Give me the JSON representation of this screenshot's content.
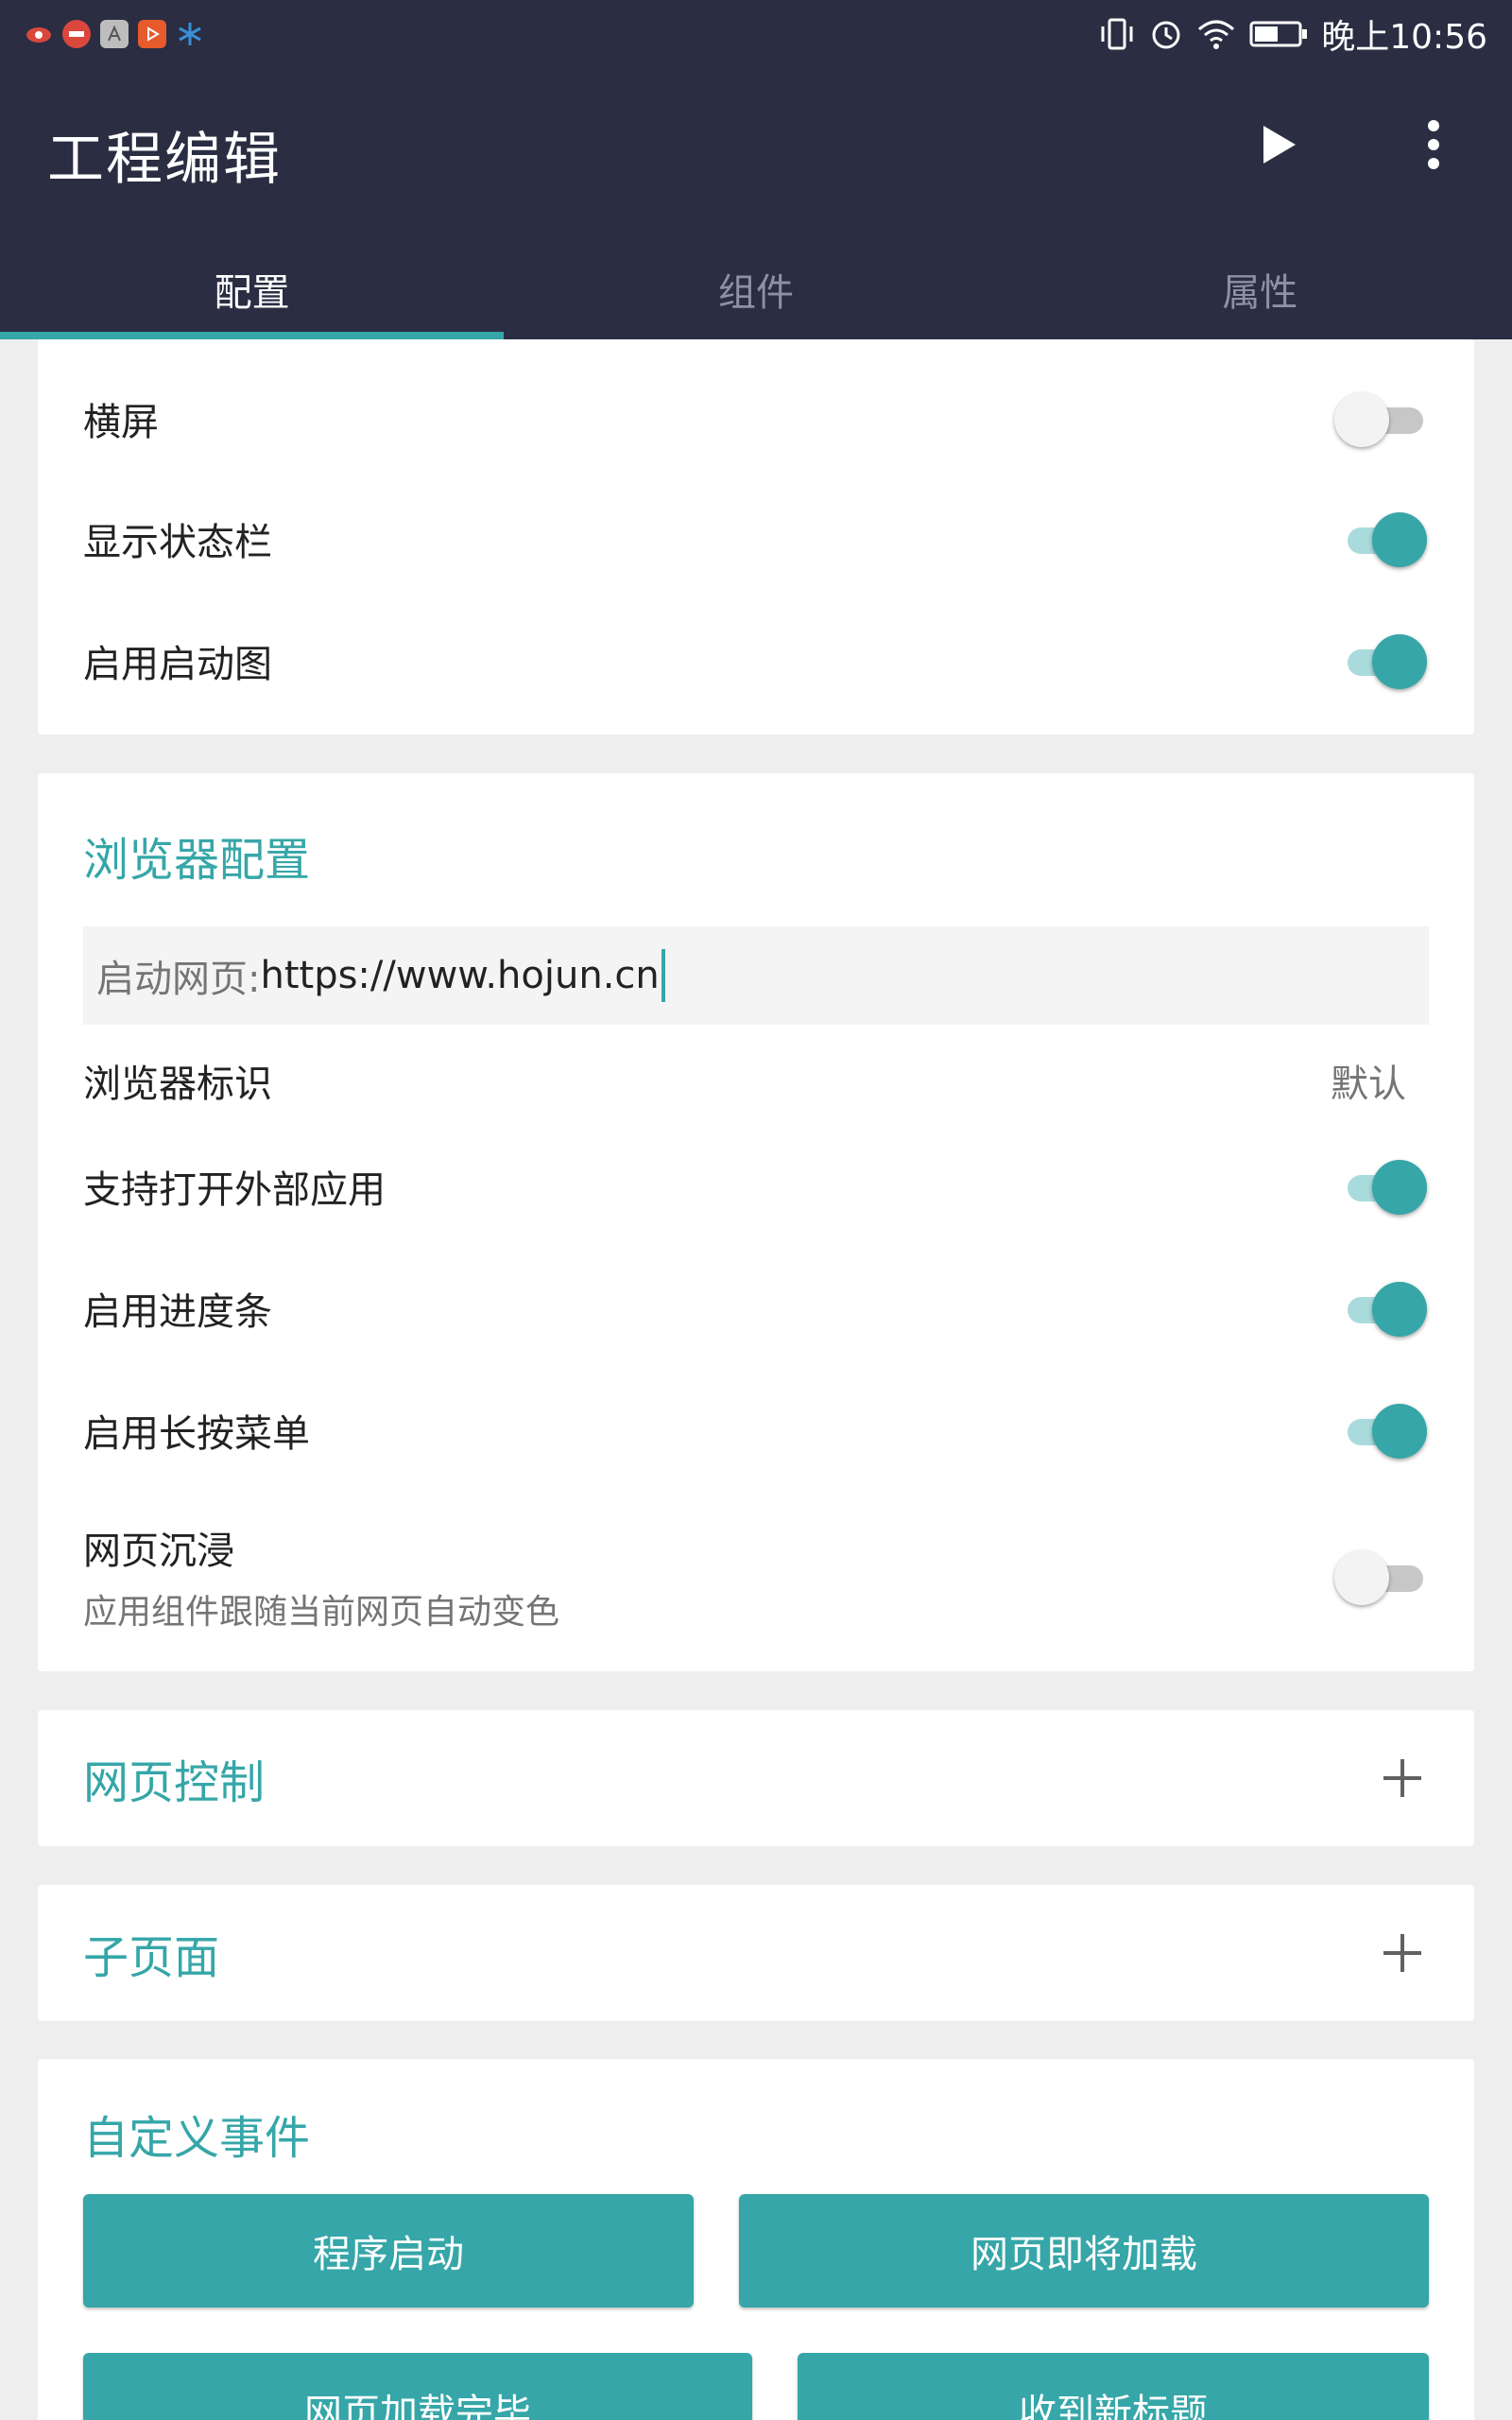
{
  "status_bar": {
    "time": "晚上10:56",
    "left_icons": [
      "eye-app-icon",
      "news-app-icon",
      "font-app-icon",
      "video-app-icon",
      "snowflake-app-icon"
    ],
    "right_icons": [
      "vibrate-icon",
      "alarm-icon",
      "wifi-icon",
      "battery-icon"
    ]
  },
  "app_bar": {
    "title": "工程编辑",
    "actions": [
      "play-icon",
      "more-vert-icon"
    ]
  },
  "tabs": [
    {
      "label": "配置",
      "active": true
    },
    {
      "label": "组件",
      "active": false
    },
    {
      "label": "属性",
      "active": false
    }
  ],
  "display_settings": {
    "items": [
      {
        "label": "横屏",
        "on": false
      },
      {
        "label": "显示状态栏",
        "on": true
      },
      {
        "label": "启用启动图",
        "on": true
      }
    ]
  },
  "browser_config": {
    "title": "浏览器配置",
    "start_page": {
      "label": "启动网页: ",
      "value": "https://www.hojun.cn"
    },
    "user_agent": {
      "label": "浏览器标识",
      "value": "默认"
    },
    "toggles": [
      {
        "label": "支持打开外部应用",
        "on": true
      },
      {
        "label": "启用进度条",
        "on": true
      },
      {
        "label": "启用长按菜单",
        "on": true
      }
    ],
    "immersive": {
      "label": "网页沉浸",
      "subtitle": "应用组件跟随当前网页自动变色",
      "on": false
    }
  },
  "web_control": {
    "title": "网页控制"
  },
  "sub_pages": {
    "title": "子页面"
  },
  "custom_events": {
    "title": "自定义事件",
    "buttons": [
      "程序启动",
      "网页即将加载",
      "网页加载完毕",
      "收到新标题"
    ]
  },
  "colors": {
    "primary_dark": "#2b2d42",
    "accent": "#36a6a8",
    "background": "#eeeeee"
  }
}
